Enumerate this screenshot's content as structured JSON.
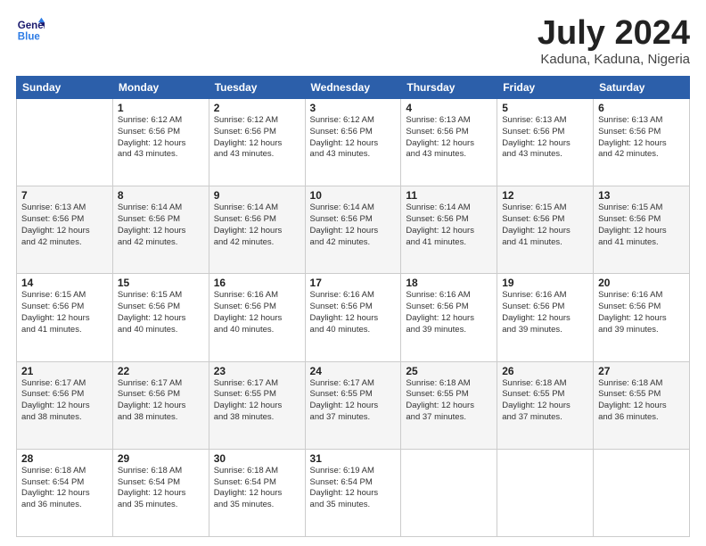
{
  "logo": {
    "line1": "General",
    "line2": "Blue"
  },
  "title": "July 2024",
  "location": "Kaduna, Kaduna, Nigeria",
  "days_header": [
    "Sunday",
    "Monday",
    "Tuesday",
    "Wednesday",
    "Thursday",
    "Friday",
    "Saturday"
  ],
  "weeks": [
    [
      {
        "day": "",
        "info": ""
      },
      {
        "day": "1",
        "info": "Sunrise: 6:12 AM\nSunset: 6:56 PM\nDaylight: 12 hours\nand 43 minutes."
      },
      {
        "day": "2",
        "info": "Sunrise: 6:12 AM\nSunset: 6:56 PM\nDaylight: 12 hours\nand 43 minutes."
      },
      {
        "day": "3",
        "info": "Sunrise: 6:12 AM\nSunset: 6:56 PM\nDaylight: 12 hours\nand 43 minutes."
      },
      {
        "day": "4",
        "info": "Sunrise: 6:13 AM\nSunset: 6:56 PM\nDaylight: 12 hours\nand 43 minutes."
      },
      {
        "day": "5",
        "info": "Sunrise: 6:13 AM\nSunset: 6:56 PM\nDaylight: 12 hours\nand 43 minutes."
      },
      {
        "day": "6",
        "info": "Sunrise: 6:13 AM\nSunset: 6:56 PM\nDaylight: 12 hours\nand 42 minutes."
      }
    ],
    [
      {
        "day": "7",
        "info": "Sunrise: 6:13 AM\nSunset: 6:56 PM\nDaylight: 12 hours\nand 42 minutes."
      },
      {
        "day": "8",
        "info": "Sunrise: 6:14 AM\nSunset: 6:56 PM\nDaylight: 12 hours\nand 42 minutes."
      },
      {
        "day": "9",
        "info": "Sunrise: 6:14 AM\nSunset: 6:56 PM\nDaylight: 12 hours\nand 42 minutes."
      },
      {
        "day": "10",
        "info": "Sunrise: 6:14 AM\nSunset: 6:56 PM\nDaylight: 12 hours\nand 42 minutes."
      },
      {
        "day": "11",
        "info": "Sunrise: 6:14 AM\nSunset: 6:56 PM\nDaylight: 12 hours\nand 41 minutes."
      },
      {
        "day": "12",
        "info": "Sunrise: 6:15 AM\nSunset: 6:56 PM\nDaylight: 12 hours\nand 41 minutes."
      },
      {
        "day": "13",
        "info": "Sunrise: 6:15 AM\nSunset: 6:56 PM\nDaylight: 12 hours\nand 41 minutes."
      }
    ],
    [
      {
        "day": "14",
        "info": "Sunrise: 6:15 AM\nSunset: 6:56 PM\nDaylight: 12 hours\nand 41 minutes."
      },
      {
        "day": "15",
        "info": "Sunrise: 6:15 AM\nSunset: 6:56 PM\nDaylight: 12 hours\nand 40 minutes."
      },
      {
        "day": "16",
        "info": "Sunrise: 6:16 AM\nSunset: 6:56 PM\nDaylight: 12 hours\nand 40 minutes."
      },
      {
        "day": "17",
        "info": "Sunrise: 6:16 AM\nSunset: 6:56 PM\nDaylight: 12 hours\nand 40 minutes."
      },
      {
        "day": "18",
        "info": "Sunrise: 6:16 AM\nSunset: 6:56 PM\nDaylight: 12 hours\nand 39 minutes."
      },
      {
        "day": "19",
        "info": "Sunrise: 6:16 AM\nSunset: 6:56 PM\nDaylight: 12 hours\nand 39 minutes."
      },
      {
        "day": "20",
        "info": "Sunrise: 6:16 AM\nSunset: 6:56 PM\nDaylight: 12 hours\nand 39 minutes."
      }
    ],
    [
      {
        "day": "21",
        "info": "Sunrise: 6:17 AM\nSunset: 6:56 PM\nDaylight: 12 hours\nand 38 minutes."
      },
      {
        "day": "22",
        "info": "Sunrise: 6:17 AM\nSunset: 6:56 PM\nDaylight: 12 hours\nand 38 minutes."
      },
      {
        "day": "23",
        "info": "Sunrise: 6:17 AM\nSunset: 6:55 PM\nDaylight: 12 hours\nand 38 minutes."
      },
      {
        "day": "24",
        "info": "Sunrise: 6:17 AM\nSunset: 6:55 PM\nDaylight: 12 hours\nand 37 minutes."
      },
      {
        "day": "25",
        "info": "Sunrise: 6:18 AM\nSunset: 6:55 PM\nDaylight: 12 hours\nand 37 minutes."
      },
      {
        "day": "26",
        "info": "Sunrise: 6:18 AM\nSunset: 6:55 PM\nDaylight: 12 hours\nand 37 minutes."
      },
      {
        "day": "27",
        "info": "Sunrise: 6:18 AM\nSunset: 6:55 PM\nDaylight: 12 hours\nand 36 minutes."
      }
    ],
    [
      {
        "day": "28",
        "info": "Sunrise: 6:18 AM\nSunset: 6:54 PM\nDaylight: 12 hours\nand 36 minutes."
      },
      {
        "day": "29",
        "info": "Sunrise: 6:18 AM\nSunset: 6:54 PM\nDaylight: 12 hours\nand 35 minutes."
      },
      {
        "day": "30",
        "info": "Sunrise: 6:18 AM\nSunset: 6:54 PM\nDaylight: 12 hours\nand 35 minutes."
      },
      {
        "day": "31",
        "info": "Sunrise: 6:19 AM\nSunset: 6:54 PM\nDaylight: 12 hours\nand 35 minutes."
      },
      {
        "day": "",
        "info": ""
      },
      {
        "day": "",
        "info": ""
      },
      {
        "day": "",
        "info": ""
      }
    ]
  ]
}
